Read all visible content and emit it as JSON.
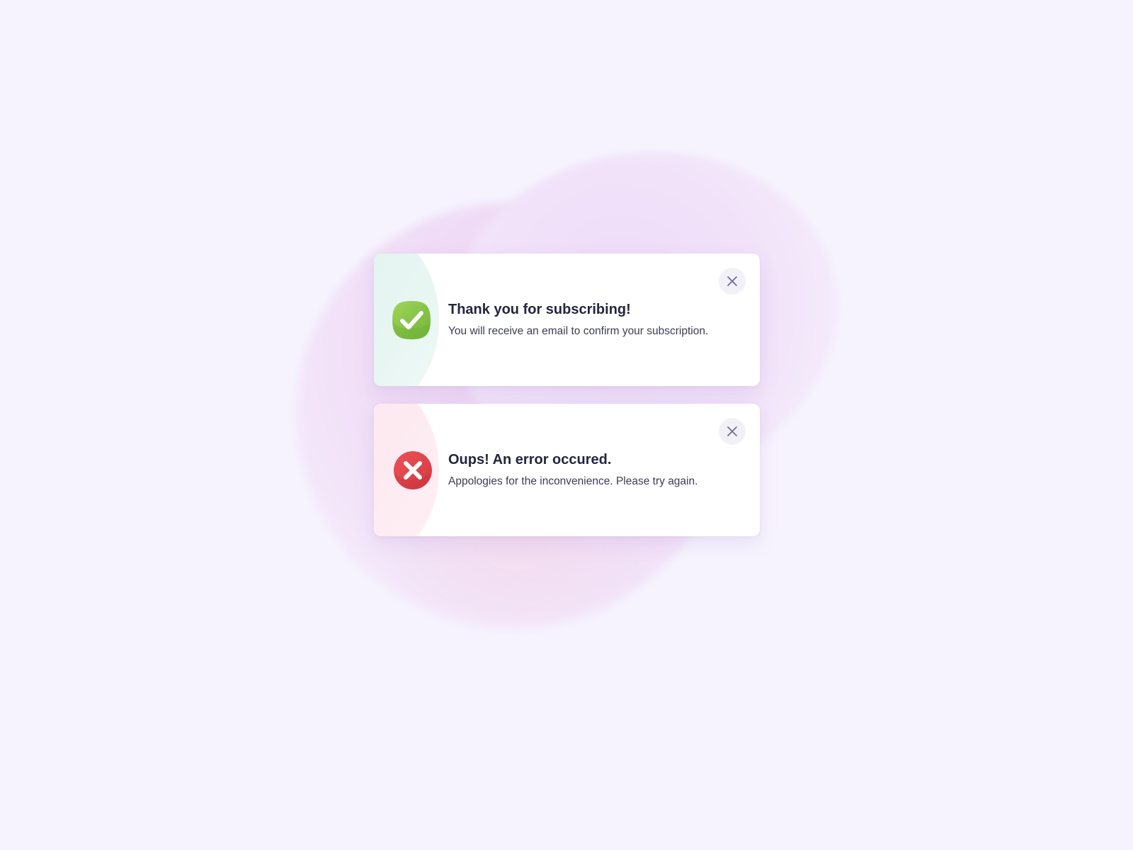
{
  "colors": {
    "background": "#f6f3fe",
    "success": "#8cc84b",
    "error": "#e0434b",
    "title_text": "#24253f",
    "body_text": "#3c3d52",
    "close_icon": "#6f6e8c"
  },
  "toasts": [
    {
      "type": "success",
      "icon": "check-icon",
      "title": "Thank you for subscribing!",
      "message": "You will receive an email to confirm your subscription.",
      "close_icon": "close-icon"
    },
    {
      "type": "error",
      "icon": "error-x-icon",
      "title": "Oups! An error occured.",
      "message": "Appologies for the inconvenience. Please try again.",
      "close_icon": "close-icon"
    }
  ]
}
